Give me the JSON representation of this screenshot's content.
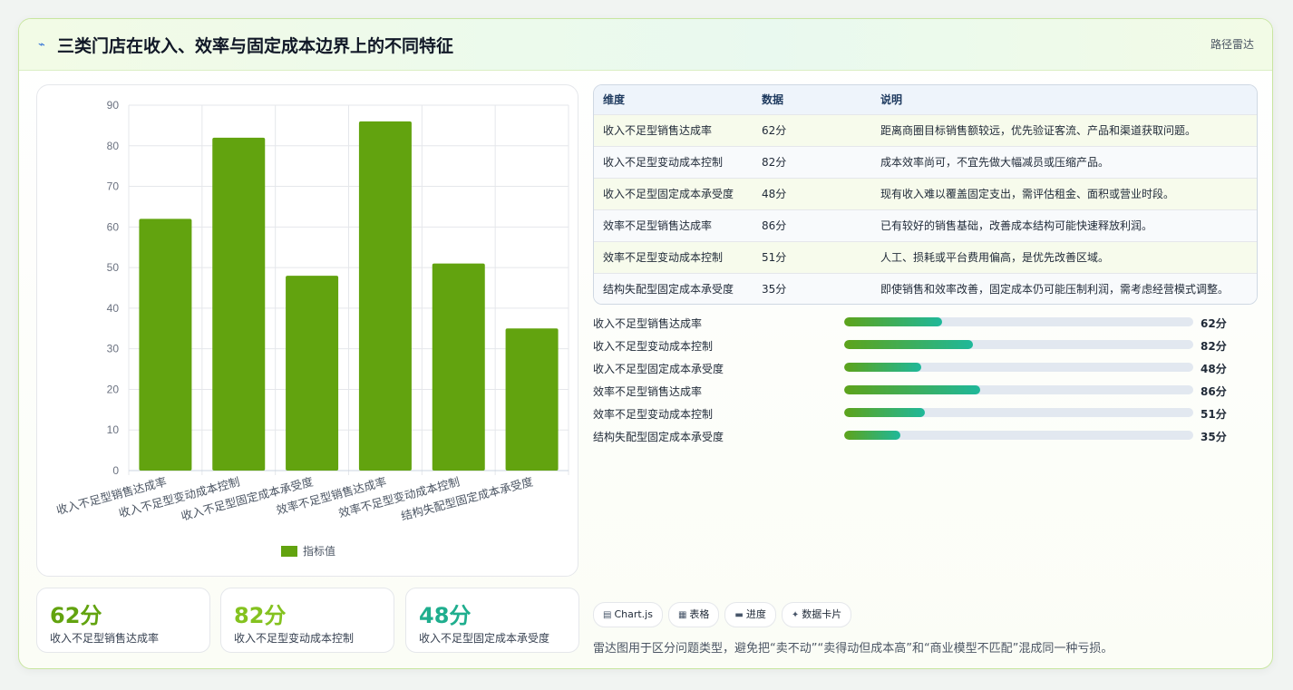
{
  "header": {
    "icon": "lightning-bolt-icon",
    "title": "三类门店在收入、效率与固定成本边界上的不同特征",
    "subtitle": "路径雷达"
  },
  "chart_data": {
    "type": "bar",
    "categories": [
      "收入不足型销售达成率",
      "收入不足型变动成本控制",
      "收入不足型固定成本承受度",
      "效率不足型销售达成率",
      "效率不足型变动成本控制",
      "结构失配型固定成本承受度"
    ],
    "series": [
      {
        "name": "指标值",
        "values": [
          62,
          82,
          48,
          86,
          51,
          35
        ]
      }
    ],
    "ylim": [
      0,
      90
    ],
    "yticks": [
      0,
      10,
      20,
      30,
      40,
      50,
      60,
      70,
      80,
      90
    ],
    "grid": true,
    "legend": "bottom",
    "bar_color": "#62a30f"
  },
  "stats": [
    {
      "value": "62分",
      "label": "收入不足型销售达成率",
      "color": "#62a30f"
    },
    {
      "value": "82分",
      "label": "收入不足型变动成本控制",
      "color": "#84c21f"
    },
    {
      "value": "48分",
      "label": "收入不足型固定成本承受度",
      "color": "#1fae8e"
    }
  ],
  "table": {
    "headers": [
      "维度",
      "数据",
      "说明"
    ],
    "rows": [
      {
        "dim": "收入不足型销售达成率",
        "val": "62分",
        "desc": "距离商圈目标销售额较远，优先验证客流、产品和渠道获取问题。"
      },
      {
        "dim": "收入不足型变动成本控制",
        "val": "82分",
        "desc": "成本效率尚可，不宜先做大幅减员或压缩产品。"
      },
      {
        "dim": "收入不足型固定成本承受度",
        "val": "48分",
        "desc": "现有收入难以覆盖固定支出，需评估租金、面积或营业时段。"
      },
      {
        "dim": "效率不足型销售达成率",
        "val": "86分",
        "desc": "已有较好的销售基础，改善成本结构可能快速释放利润。"
      },
      {
        "dim": "效率不足型变动成本控制",
        "val": "51分",
        "desc": "人工、损耗或平台费用偏高，是优先改善区域。"
      },
      {
        "dim": "结构失配型固定成本承受度",
        "val": "35分",
        "desc": "即使销售和效率改善，固定成本仍可能压制利润，需考虑经营模式调整。"
      }
    ]
  },
  "progress": [
    {
      "label": "收入不足型销售达成率",
      "value": "62分",
      "fill": 0.28
    },
    {
      "label": "收入不足型变动成本控制",
      "value": "82分",
      "fill": 0.37
    },
    {
      "label": "收入不足型固定成本承受度",
      "value": "48分",
      "fill": 0.22
    },
    {
      "label": "效率不足型销售达成率",
      "value": "86分",
      "fill": 0.39
    },
    {
      "label": "效率不足型变动成本控制",
      "value": "51分",
      "fill": 0.23
    },
    {
      "label": "结构失配型固定成本承受度",
      "value": "35分",
      "fill": 0.16
    }
  ],
  "chips": [
    {
      "icon": "chart-icon",
      "glyph": "▤",
      "label": "Chart.js"
    },
    {
      "icon": "table-icon",
      "glyph": "▦",
      "label": "表格"
    },
    {
      "icon": "progress-icon",
      "glyph": "▬",
      "label": "进度"
    },
    {
      "icon": "sparkle-icon",
      "glyph": "✦",
      "label": "数据卡片"
    }
  ],
  "note": "雷达图用于区分问题类型，避免把“卖不动”“卖得动但成本高”和“商业模型不匹配”混成同一种亏损。"
}
